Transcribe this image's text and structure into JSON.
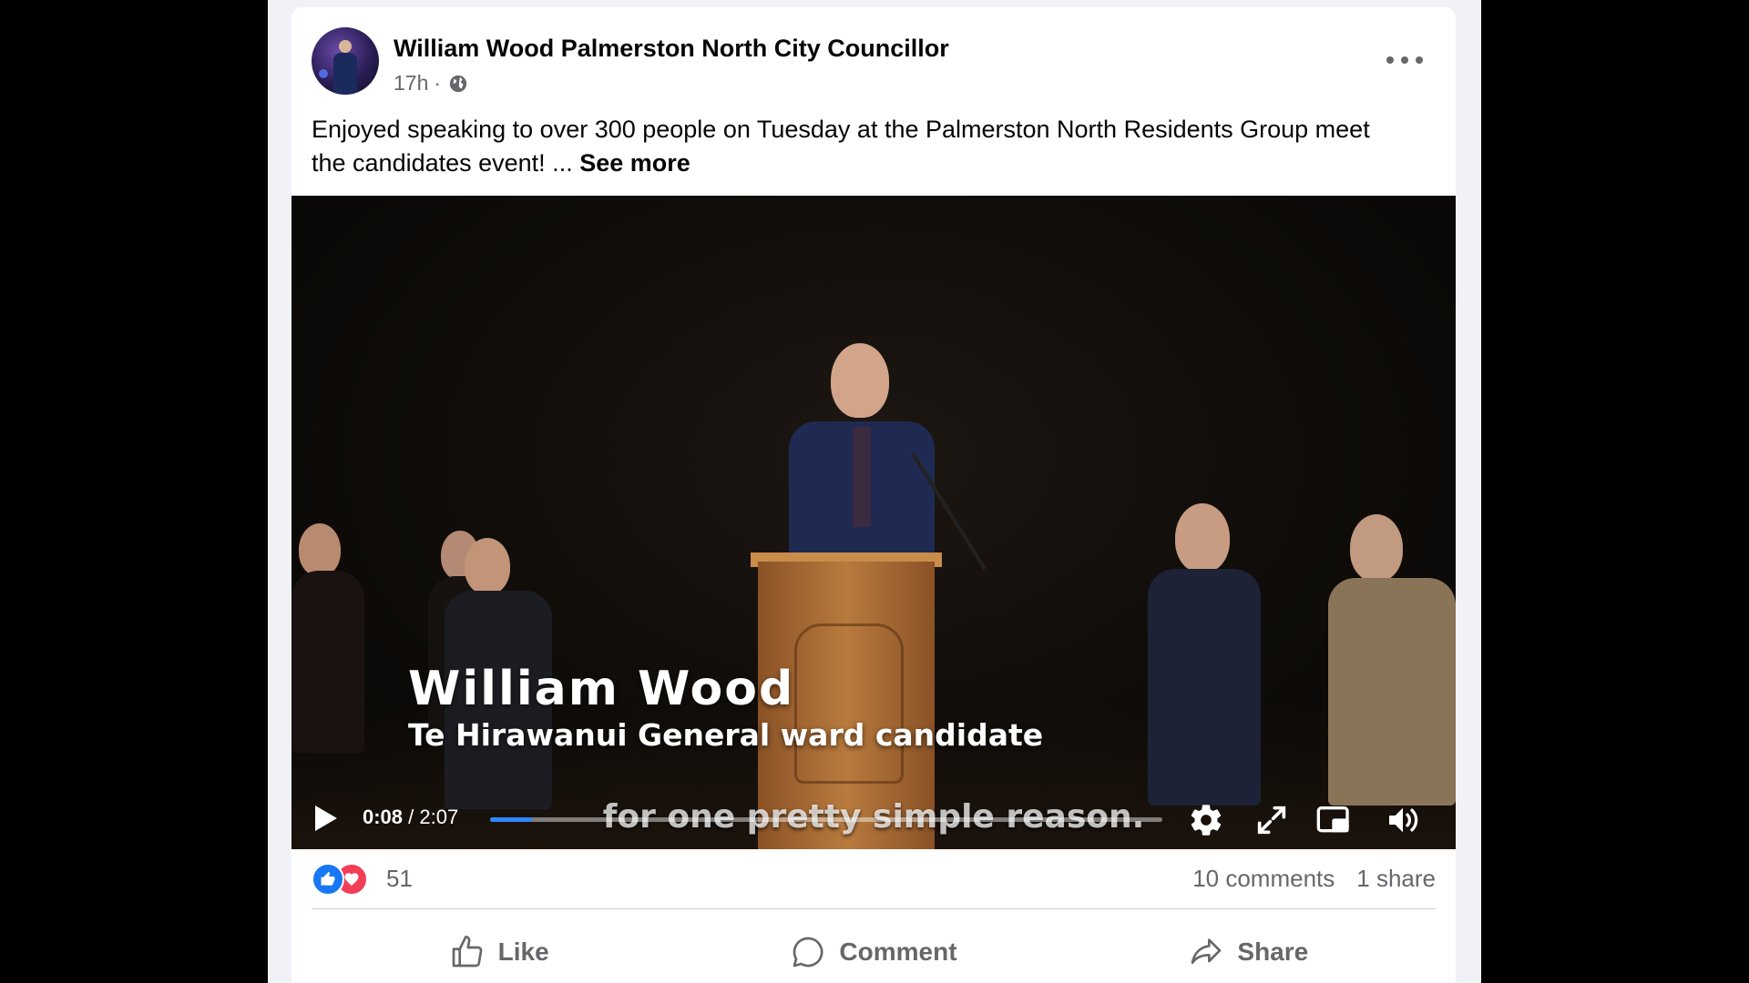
{
  "post": {
    "page_name": "William Wood Palmerston North City Councillor",
    "timestamp": "17h",
    "separator": "·",
    "audience_icon": "globe-icon",
    "text": "Enjoyed speaking to over 300 people on Tuesday at the Palmerston North Residents Group meet the candidates event! ...",
    "see_more": "See more"
  },
  "video": {
    "lower_third_name": "William Wood",
    "lower_third_subtitle": "Te Hirawanui General ward candidate",
    "caption": "for one pretty simple reason.",
    "current_time": "0:08",
    "time_separator": " / ",
    "duration": "2:07",
    "progress_fraction": 0.063,
    "icons": [
      "play-icon",
      "settings-icon",
      "fullscreen-icon",
      "picture-in-picture-icon",
      "volume-icon"
    ]
  },
  "engagement": {
    "reaction_count": "51",
    "comments": "10 comments",
    "shares": "1 share",
    "reaction_icons": [
      "like-reaction-icon",
      "love-reaction-icon"
    ]
  },
  "actions": {
    "like_label": "Like",
    "comment_label": "Comment",
    "share_label": "Share"
  },
  "colors": {
    "accent": "#2d88ff",
    "like_blue": "#1877f2",
    "love_red": "#f33e58",
    "secondary_text": "#65676b"
  }
}
